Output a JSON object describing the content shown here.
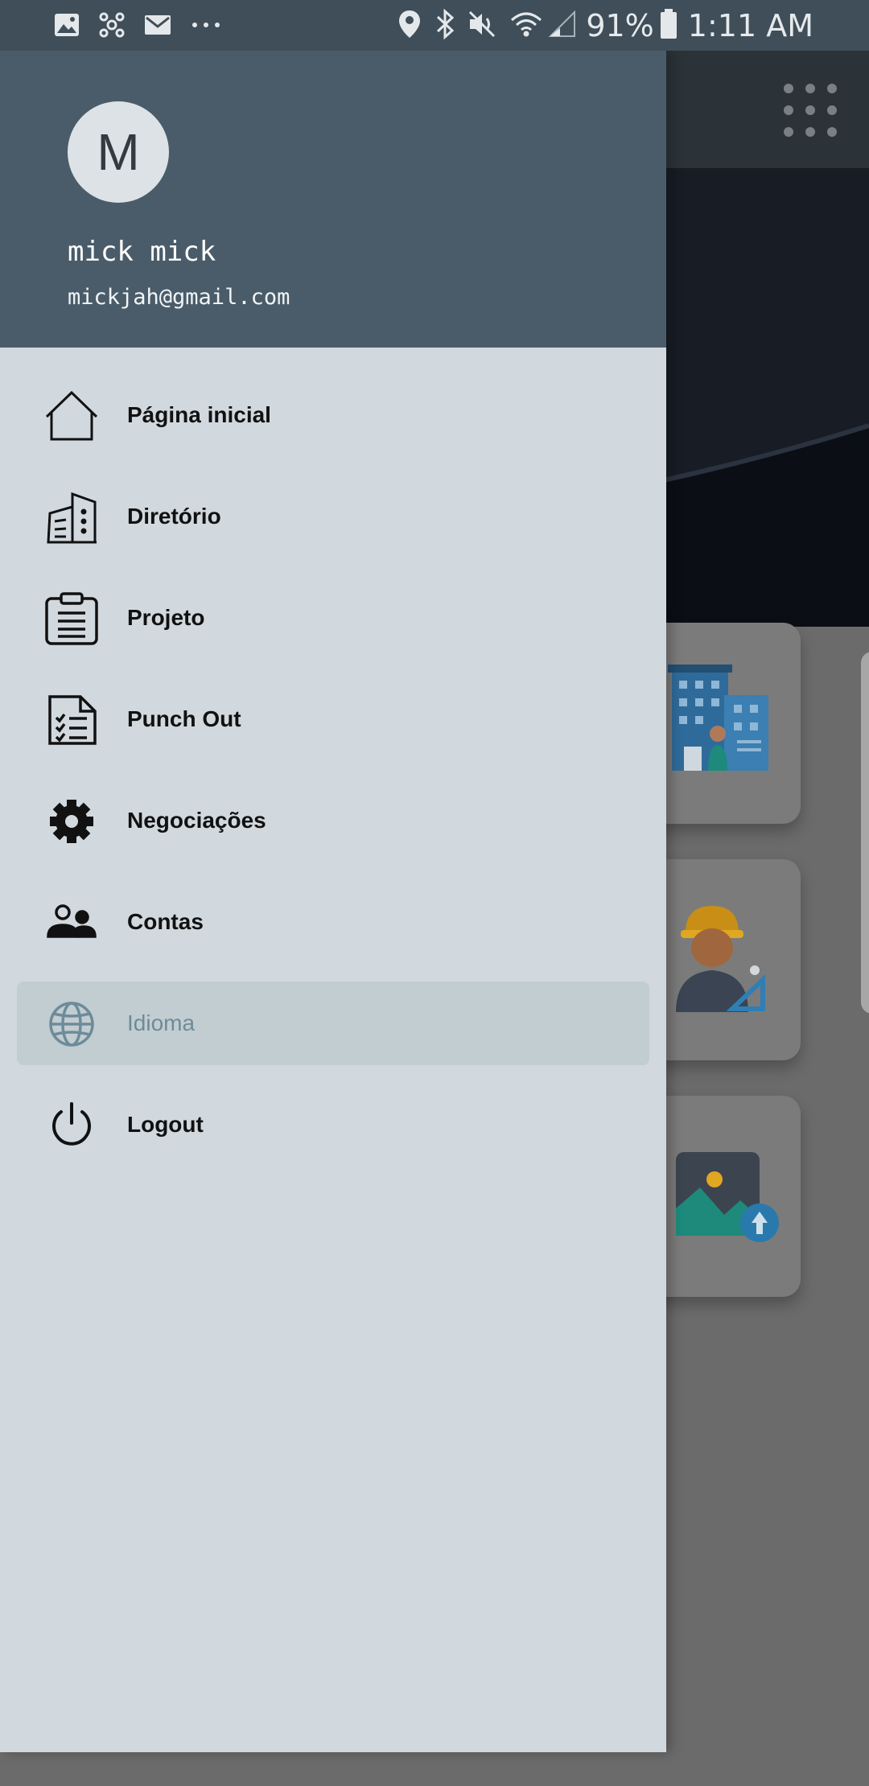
{
  "status_bar": {
    "left_icons": [
      "gallery-icon",
      "network-icon",
      "mail-icon",
      "more-dots-icon"
    ],
    "right_icons": [
      "location-icon",
      "bluetooth-icon",
      "mute-icon",
      "wifi-icon",
      "signal-icon",
      "battery-icon"
    ],
    "battery": "91%",
    "time": "1:11 AM"
  },
  "drawer": {
    "avatar_letter": "M",
    "user_name": "mick mick",
    "user_email": "mickjah@gmail.com",
    "items": [
      {
        "label": "Página inicial",
        "icon": "home-icon",
        "active": false
      },
      {
        "label": "Diretório",
        "icon": "building-icon",
        "active": false
      },
      {
        "label": "Projeto",
        "icon": "clipboard-icon",
        "active": false
      },
      {
        "label": "Punch Out",
        "icon": "checklist-icon",
        "active": false
      },
      {
        "label": "Negociações",
        "icon": "gear-icon",
        "active": false
      },
      {
        "label": "Contas",
        "icon": "users-icon",
        "active": false
      },
      {
        "label": "Idioma",
        "icon": "globe-icon",
        "active": true
      },
      {
        "label": "Logout",
        "icon": "power-icon",
        "active": false
      }
    ]
  },
  "background": {
    "toolbar_icon": "apps-grid-icon",
    "cards": [
      "building-illustration",
      "engineer-illustration",
      "image-upload-illustration"
    ]
  },
  "colors": {
    "status_bar": "#3f4e59",
    "drawer_header": "#4a5c69",
    "drawer_body": "#d1d9df",
    "active_item": "#c2cdd2",
    "active_text": "#6e8b99"
  }
}
